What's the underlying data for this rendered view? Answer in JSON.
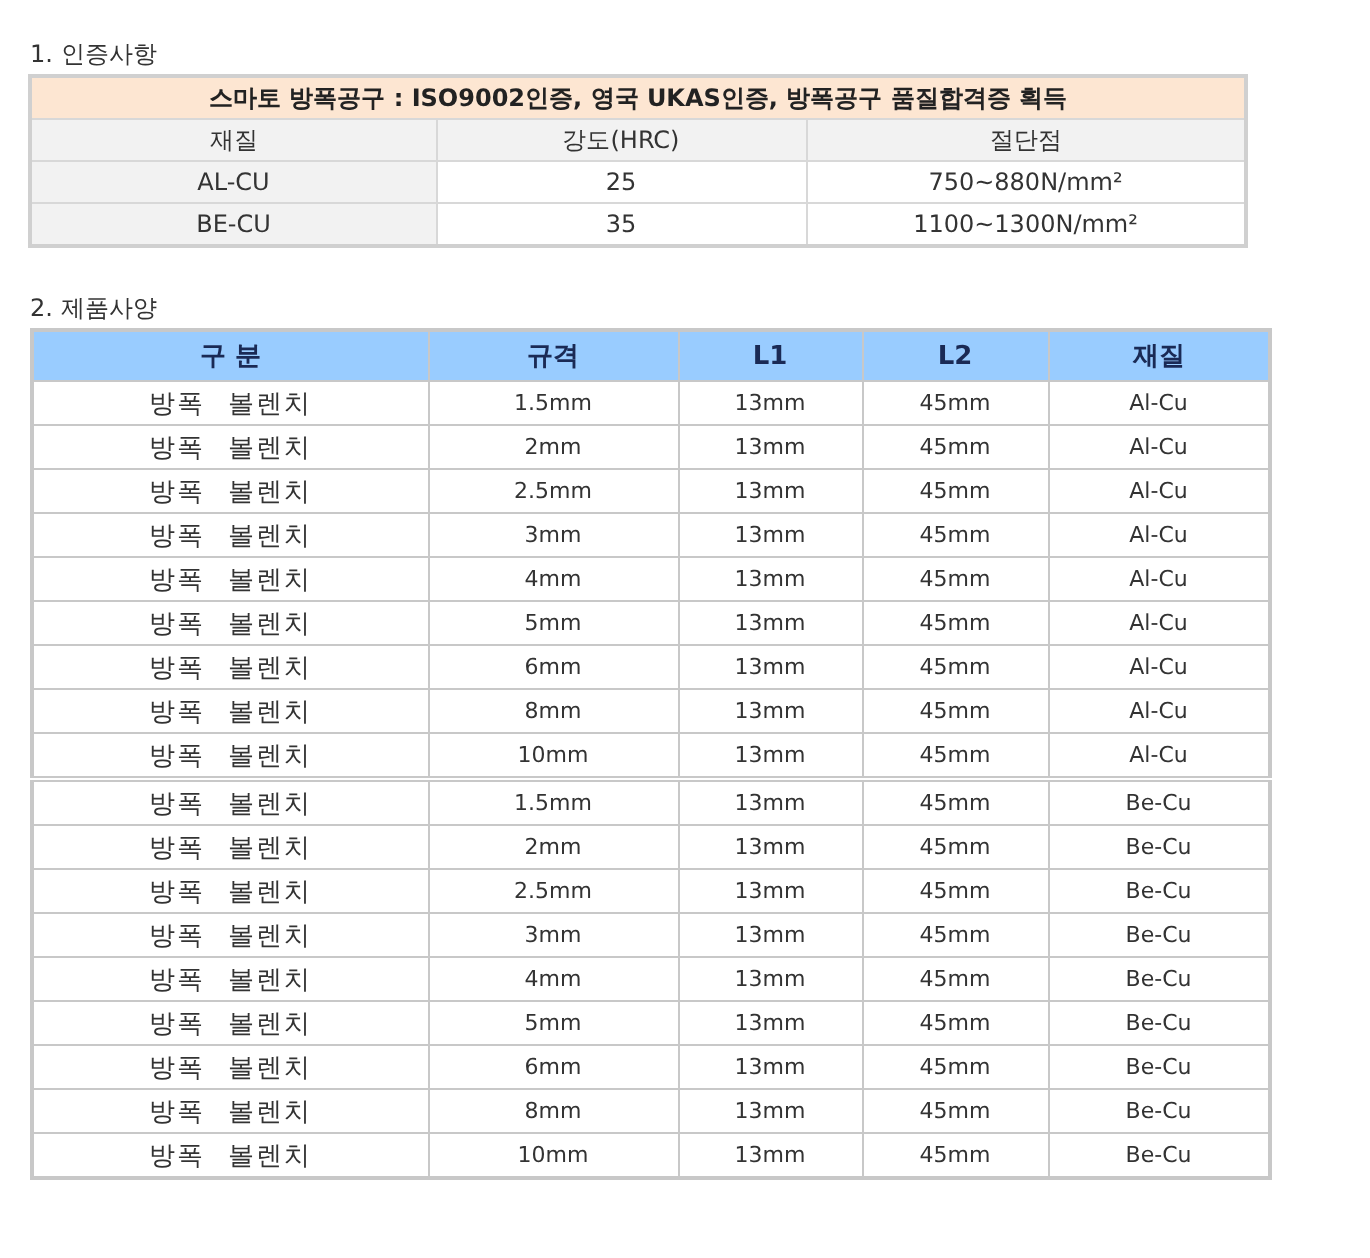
{
  "certification": {
    "heading": "1. 인증사항",
    "banner": "스마토 방폭공구 :  ISO9002인증, 영국 UKAS인증, 방폭공구 품질합격증 획득",
    "columns": [
      "재질",
      "강도(HRC)",
      "절단점"
    ],
    "rows": [
      [
        "AL-CU",
        "25",
        "750~880N/mm²"
      ],
      [
        "BE-CU",
        "35",
        "1100~1300N/mm²"
      ]
    ]
  },
  "specifications": {
    "heading": "2. 제품사양",
    "columns": [
      "구 분",
      "규격",
      "L1",
      "L2",
      "재질"
    ],
    "groups": [
      [
        [
          "방폭 볼렌치",
          "1.5mm",
          "13mm",
          "45mm",
          "Al-Cu"
        ],
        [
          "방폭 볼렌치",
          "2mm",
          "13mm",
          "45mm",
          "Al-Cu"
        ],
        [
          "방폭 볼렌치",
          "2.5mm",
          "13mm",
          "45mm",
          "Al-Cu"
        ],
        [
          "방폭 볼렌치",
          "3mm",
          "13mm",
          "45mm",
          "Al-Cu"
        ],
        [
          "방폭 볼렌치",
          "4mm",
          "13mm",
          "45mm",
          "Al-Cu"
        ],
        [
          "방폭 볼렌치",
          "5mm",
          "13mm",
          "45mm",
          "Al-Cu"
        ],
        [
          "방폭 볼렌치",
          "6mm",
          "13mm",
          "45mm",
          "Al-Cu"
        ],
        [
          "방폭 볼렌치",
          "8mm",
          "13mm",
          "45mm",
          "Al-Cu"
        ],
        [
          "방폭 볼렌치",
          "10mm",
          "13mm",
          "45mm",
          "Al-Cu"
        ]
      ],
      [
        [
          "방폭 볼렌치",
          "1.5mm",
          "13mm",
          "45mm",
          "Be-Cu"
        ],
        [
          "방폭 볼렌치",
          "2mm",
          "13mm",
          "45mm",
          "Be-Cu"
        ],
        [
          "방폭 볼렌치",
          "2.5mm",
          "13mm",
          "45mm",
          "Be-Cu"
        ],
        [
          "방폭 볼렌치",
          "3mm",
          "13mm",
          "45mm",
          "Be-Cu"
        ],
        [
          "방폭 볼렌치",
          "4mm",
          "13mm",
          "45mm",
          "Be-Cu"
        ],
        [
          "방폭 볼렌치",
          "5mm",
          "13mm",
          "45mm",
          "Be-Cu"
        ],
        [
          "방폭 볼렌치",
          "6mm",
          "13mm",
          "45mm",
          "Be-Cu"
        ],
        [
          "방폭 볼렌치",
          "8mm",
          "13mm",
          "45mm",
          "Be-Cu"
        ],
        [
          "방폭 볼렌치",
          "10mm",
          "13mm",
          "45mm",
          "Be-Cu"
        ]
      ]
    ]
  }
}
